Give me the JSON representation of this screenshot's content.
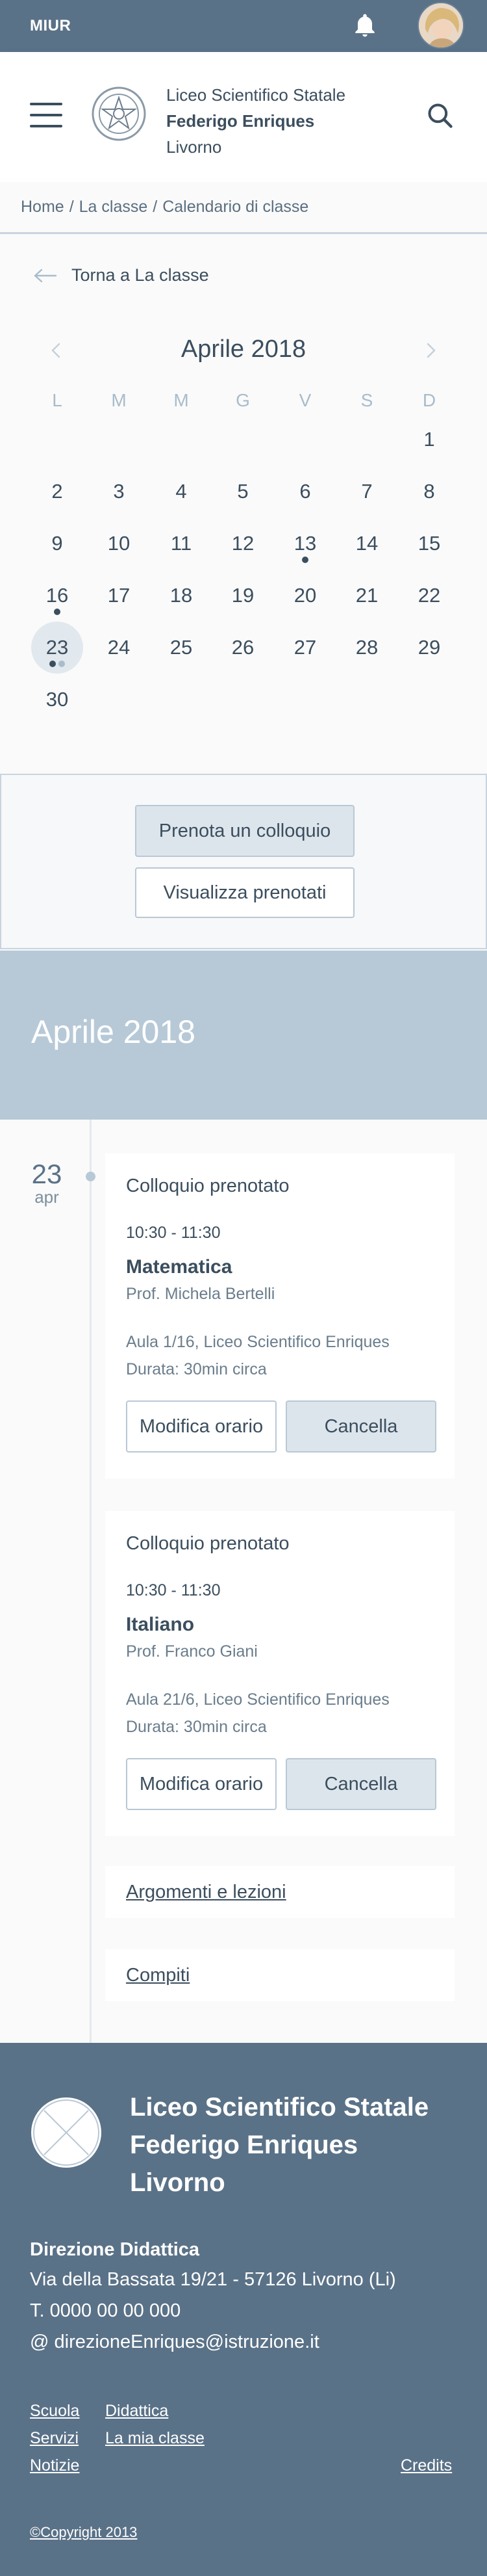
{
  "topbar": {
    "brand": "MIUR",
    "notification_icon": "bell-icon",
    "avatar_alt": "user-avatar"
  },
  "header": {
    "menu_icon": "hamburger-menu-icon",
    "school_line1": "Liceo Scientifico Statale",
    "school_line2": "Federigo Enriques",
    "school_line3": "Livorno",
    "search_icon": "search-icon"
  },
  "breadcrumb": {
    "items": [
      "Home",
      "La classe",
      "Calendario di classe"
    ],
    "separator": "/"
  },
  "back_link": {
    "label": "Torna a La classe"
  },
  "calendar": {
    "month_label": "Aprile 2018",
    "weekdays": [
      "L",
      "M",
      "M",
      "G",
      "V",
      "S",
      "D"
    ],
    "days": [
      "1",
      "2",
      "3",
      "4",
      "5",
      "6",
      "7",
      "8",
      "9",
      "10",
      "11",
      "12",
      "13",
      "14",
      "15",
      "16",
      "17",
      "18",
      "19",
      "20",
      "21",
      "22",
      "23",
      "24",
      "25",
      "26",
      "27",
      "28",
      "29",
      "30"
    ],
    "selected_day": "23",
    "days_with_events": [
      "13",
      "16",
      "23"
    ]
  },
  "actions": {
    "book_label": "Prenota un colloquio",
    "view_label": "Visualizza prenotati"
  },
  "month_banner": {
    "title": "Aprile 2018"
  },
  "timeline": {
    "date_day": "23",
    "date_month": "apr",
    "cards": [
      {
        "title": "Colloquio prenotato",
        "time": "10:30 - 11:30",
        "subject": "Matematica",
        "teacher": "Prof. Michela Bertelli",
        "place": "Aula 1/16, Liceo Scientifico Enriques",
        "duration": "Durata: 30min circa",
        "edit_label": "Modifica orario",
        "cancel_label": "Cancella"
      },
      {
        "title": "Colloquio prenotato",
        "time": "10:30 - 11:30",
        "subject": "Italiano",
        "teacher": "Prof. Franco Giani",
        "place": "Aula 21/6, Liceo Scientifico Enriques",
        "duration": "Durata: 30min circa",
        "edit_label": "Modifica orario",
        "cancel_label": "Cancella"
      }
    ],
    "links": [
      "Argomenti e lezioni",
      "Compiti"
    ]
  },
  "footer": {
    "name_line1": "Liceo Scientifico Statale",
    "name_line2": "Federigo Enriques",
    "name_line3": "Livorno",
    "direction_title": "Direzione Didattica",
    "address": "Via della Bassata 19/21 - 57126 Livorno (Li)",
    "phone": "T. 0000 00 00 000",
    "email": "@ direzioneEnriques@istruzione.it",
    "links_col1": [
      "Scuola",
      "Servizi",
      "Notizie"
    ],
    "links_col2": [
      "Didattica",
      "La mia classe"
    ],
    "credits": "Credits",
    "copyright": "©Copyright 2013"
  },
  "colors": {
    "primary": "#5a7288",
    "banner": "#b7c9d7",
    "text": "#3b4e5e",
    "button_fill": "#dde5ec"
  }
}
